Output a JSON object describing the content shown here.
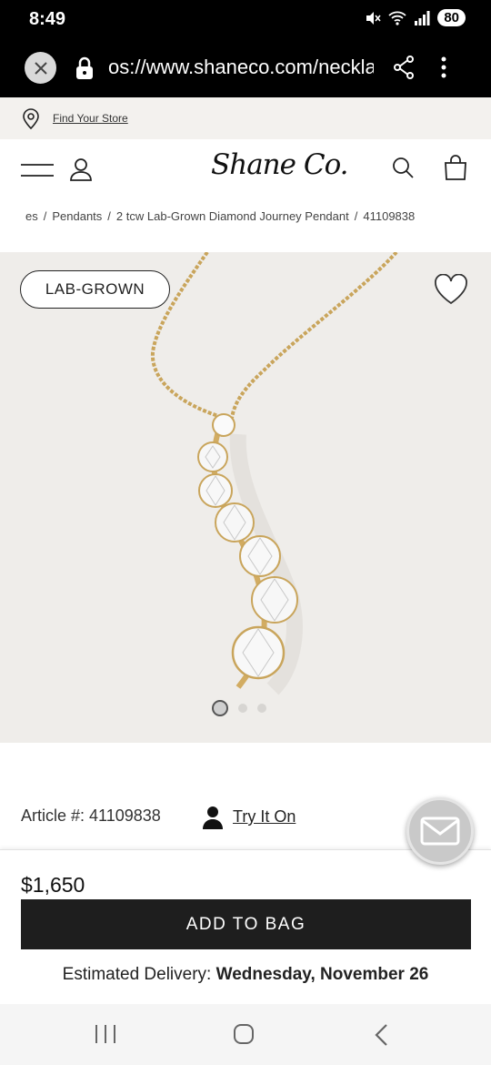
{
  "status_bar": {
    "time": "8:49",
    "battery": "80"
  },
  "browser": {
    "url": "os://www.shaneco.com/neckla"
  },
  "store_strip": {
    "find_store": "Find Your Store"
  },
  "header": {
    "logo": "Shane Co."
  },
  "breadcrumb": {
    "items": [
      "es",
      "Pendants",
      "2 tcw Lab-Grown Diamond Journey Pendant",
      "41109838"
    ],
    "separator": "/"
  },
  "hero": {
    "badge": "LAB-GROWN",
    "carousel_count": 3,
    "carousel_active": 1
  },
  "product": {
    "article_label": "Article #: 41109838",
    "try_on": "Try It On",
    "price": "$1,650",
    "add_to_bag": "ADD TO BAG",
    "delivery_label": "Estimated Delivery:",
    "delivery_date": "Wednesday, November 26"
  },
  "colors": {
    "accent_dark": "#1e1e1e",
    "gold": "#d4b06a",
    "hero_bg": "#efedea"
  }
}
